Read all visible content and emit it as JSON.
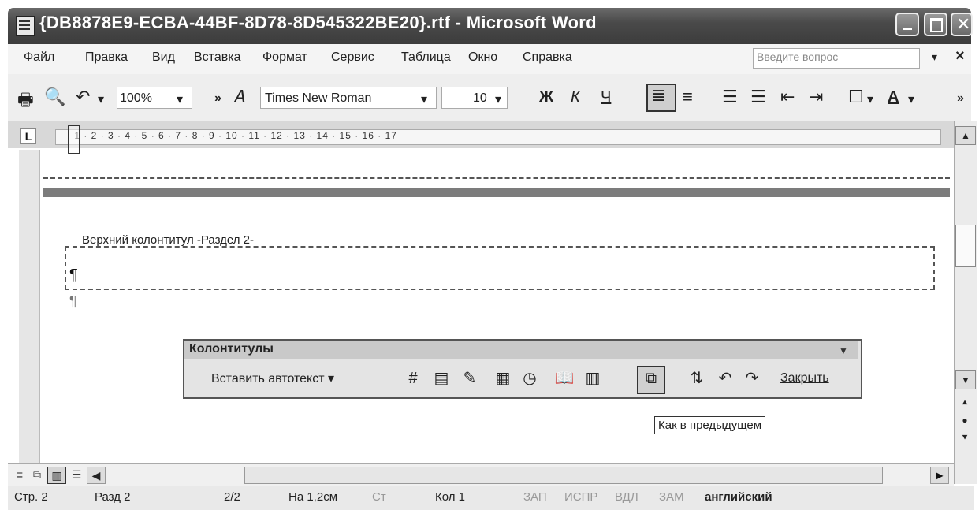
{
  "window": {
    "title": "{DB8878E9-ECBA-44BF-8D78-8D545322BE20}.rtf - Microsoft Word"
  },
  "menu": {
    "items": [
      "Файл",
      "Правка",
      "Вид",
      "Вставка",
      "Формат",
      "Сервис",
      "Таблица",
      "Окно",
      "Справка"
    ],
    "ask_placeholder": "Введите вопрос",
    "close_glyph": "×"
  },
  "toolbar": {
    "zoom": "100%",
    "font_name": "Times New Roman",
    "font_size": "10",
    "bold": "Ж",
    "italic": "К",
    "underline": "Ч"
  },
  "ruler": {
    "numbers": "· 1 · 2 · 3 · 4 · 5 · 6 · 7 · 8 · 9 · 10 · 11 · 12 · 13 · 14 · 15 · 16 · 17"
  },
  "document": {
    "header_label": "Верхний колонтитул -Раздел 2-",
    "paragraph_mark": "¶"
  },
  "hf_toolbar": {
    "title": "Колонтитулы",
    "insert_autotext": "Вставить автотекст ▾",
    "close": "Закрыть",
    "tooltip": "Как в предыдущем"
  },
  "status": {
    "page": "Стр. 2",
    "section": "Разд 2",
    "pages": "2/2",
    "at": "На 1,2см",
    "line": "Ст",
    "col": "Кол 1",
    "rec": "ЗАП",
    "trk": "ИСПР",
    "ext": "ВДЛ",
    "ovr": "ЗАМ",
    "language": "английский"
  }
}
